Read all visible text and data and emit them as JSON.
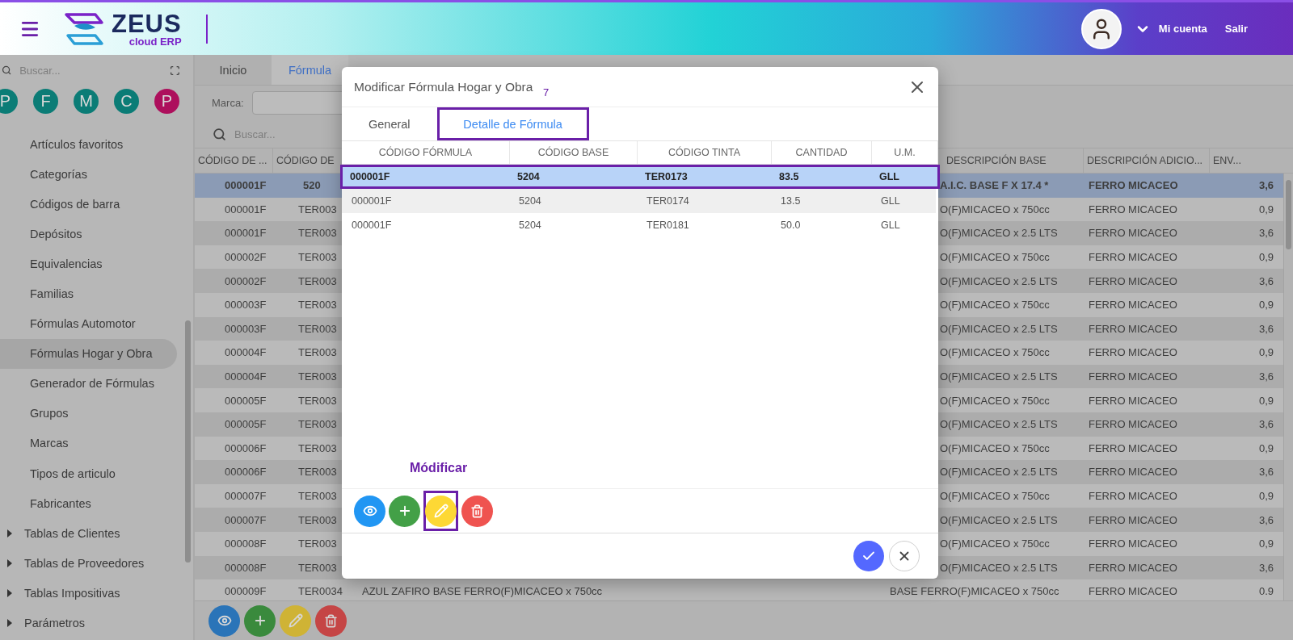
{
  "header": {
    "brand": "ZEUS",
    "tagline": "cloud ERP",
    "account": "Mi cuenta",
    "logout": "Salir"
  },
  "sidebar": {
    "search_placeholder": "Buscar...",
    "shortcuts": [
      {
        "letter": "P",
        "color": "#0b7c76"
      },
      {
        "letter": "F",
        "color": "#0b7c76"
      },
      {
        "letter": "M",
        "color": "#0b7c76"
      },
      {
        "letter": "C",
        "color": "#0b7c76"
      },
      {
        "letter": "P",
        "color": "#ad0f5c"
      }
    ],
    "items": [
      {
        "children": [
          {
            "label": "Artículos favoritos",
            "selected": false
          },
          {
            "label": "Categorías",
            "selected": false
          },
          {
            "label": "Códigos de barra",
            "selected": false
          },
          {
            "label": "Depósitos",
            "selected": false
          },
          {
            "label": "Equivalencias",
            "selected": false
          },
          {
            "label": "Familias",
            "selected": false
          },
          {
            "label": "Fórmulas Automotor",
            "selected": false
          },
          {
            "label": "Fórmulas Hogar y Obra",
            "selected": true
          },
          {
            "label": "Generador de Fórmulas",
            "selected": false
          },
          {
            "label": "Grupos",
            "selected": false
          },
          {
            "label": "Marcas",
            "selected": false
          },
          {
            "label": "Tipos de articulo",
            "selected": false
          },
          {
            "label": "Fabricantes",
            "selected": false
          }
        ]
      },
      {
        "label": "Tablas de Clientes",
        "expanded": false
      },
      {
        "label": "Tablas de Proveedores",
        "expanded": false
      },
      {
        "label": "Tablas Impositivas",
        "expanded": false
      },
      {
        "label": "Parámetros",
        "expanded": false
      }
    ]
  },
  "tabs": [
    {
      "label": "Inicio",
      "selected": false
    },
    {
      "label": "Fórmula",
      "selected": true
    }
  ],
  "filter": {
    "label": "Marca:"
  },
  "search": {
    "placeholder": "Buscar..."
  },
  "table": {
    "columns": [
      "CÓDIGO DE ...",
      "CÓDIGO DE",
      "DESCRIPCIÓN BASE",
      "DESCRIPCIÓN ADICIO...",
      "ENV..."
    ],
    "rows": [
      {
        "code": "000001F",
        "column_2": "520",
        "description_base": "A.I.C. BASE F X 17.4 *",
        "description_extra": "FERRO MICACEO",
        "env": "3,6",
        "selected": true
      },
      {
        "code": "000001F",
        "column_2": "TER003",
        "description_base": "O(F)MICACEO x 750cc",
        "description_extra": "FERRO MICACEO",
        "env": "0,9",
        "selected": false
      },
      {
        "code": "000001F",
        "column_2": "TER003",
        "description_base": "O(F)MICACEO x 2.5 LTS",
        "description_extra": "FERRO MICACEO",
        "env": "3,6",
        "selected": false
      },
      {
        "code": "000002F",
        "column_2": "TER003",
        "description_base": "O(F)MICACEO x 750cc",
        "description_extra": "FERRO MICACEO",
        "env": "0,9",
        "selected": false
      },
      {
        "code": "000002F",
        "column_2": "TER003",
        "description_base": "O(F)MICACEO x 2.5 LTS",
        "description_extra": "FERRO MICACEO",
        "env": "3,6",
        "selected": false
      },
      {
        "code": "000003F",
        "column_2": "TER003",
        "description_base": "O(F)MICACEO x 750cc",
        "description_extra": "FERRO MICACEO",
        "env": "0,9",
        "selected": false
      },
      {
        "code": "000003F",
        "column_2": "TER003",
        "description_base": "O(F)MICACEO x 2.5 LTS",
        "description_extra": "FERRO MICACEO",
        "env": "3,6",
        "selected": false
      },
      {
        "code": "000004F",
        "column_2": "TER003",
        "description_base": "O(F)MICACEO x 750cc",
        "description_extra": "FERRO MICACEO",
        "env": "0,9",
        "selected": false
      },
      {
        "code": "000004F",
        "column_2": "TER003",
        "description_base": "O(F)MICACEO x 2.5 LTS",
        "description_extra": "FERRO MICACEO",
        "env": "3,6",
        "selected": false
      },
      {
        "code": "000005F",
        "column_2": "TER003",
        "description_base": "O(F)MICACEO x 750cc",
        "description_extra": "FERRO MICACEO",
        "env": "0,9",
        "selected": false
      },
      {
        "code": "000005F",
        "column_2": "TER003",
        "description_base": "O(F)MICACEO x 2.5 LTS",
        "description_extra": "FERRO MICACEO",
        "env": "3,6",
        "selected": false
      },
      {
        "code": "000006F",
        "column_2": "TER003",
        "description_base": "O(F)MICACEO x 750cc",
        "description_extra": "FERRO MICACEO",
        "env": "0,9",
        "selected": false
      },
      {
        "code": "000006F",
        "column_2": "TER003",
        "description_base": "O(F)MICACEO x 2.5 LTS",
        "description_extra": "FERRO MICACEO",
        "env": "3,6",
        "selected": false
      },
      {
        "code": "000007F",
        "column_2": "TER003",
        "description_base": "O(F)MICACEO x 750cc",
        "description_extra": "FERRO MICACEO",
        "env": "0,9",
        "selected": false
      },
      {
        "code": "000007F",
        "column_2": "TER003",
        "description_base": "O(F)MICACEO x 2.5 LTS",
        "description_extra": "FERRO MICACEO",
        "env": "3,6",
        "selected": false
      },
      {
        "code": "000008F",
        "column_2": "TER003",
        "description_base": "O(F)MICACEO x 750cc",
        "description_extra": "FERRO MICACEO",
        "env": "0,9",
        "selected": false
      },
      {
        "code": "000008F",
        "column_2": "TER003",
        "description_base": "O(F)MICACEO x 2.5 LTS",
        "description_extra": "FERRO MICACEO",
        "env": "3,6",
        "selected": false
      },
      {
        "code": "000009F",
        "column_2": "TER0034",
        "description": "AZUL ZAFIRO BASE FERRO(F)MICACEO x 750cc",
        "description_base": "BASE FERRO(F)MICACEO x 750cc",
        "description_extra": "FERRO MICACEO",
        "env": "0.9",
        "selected": false
      }
    ]
  },
  "toolbar": [
    {
      "kind": "view"
    },
    {
      "kind": "add"
    },
    {
      "kind": "edit"
    },
    {
      "kind": "delete"
    }
  ],
  "dialog": {
    "title": "Modificar Fórmula Hogar y Obra",
    "step_label": "7",
    "tabs": [
      {
        "label": "General",
        "selected": false,
        "highlighted": false
      },
      {
        "label": "Detalle de Fórmula",
        "selected": true,
        "highlighted": true
      }
    ],
    "columns": [
      "CÓDIGO FÓRMULA",
      "CÓDIGO BASE",
      "CÓDIGO TINTA",
      "CANTIDAD",
      "U.M."
    ],
    "rows": [
      {
        "cells": [
          "000001F",
          "5204",
          "TER0173",
          "83.5",
          "GLL"
        ],
        "selected": true,
        "highlighted": true
      },
      {
        "cells": [
          "000001F",
          "5204",
          "TER0174",
          "13.5",
          "GLL"
        ],
        "selected": false,
        "highlighted": false
      },
      {
        "cells": [
          "000001F",
          "5204",
          "TER0181",
          "50.0",
          "GLL"
        ],
        "selected": false,
        "highlighted": false
      }
    ],
    "callout": "Módificar",
    "actions": [
      {
        "kind": "view",
        "highlighted": false
      },
      {
        "kind": "add",
        "highlighted": false
      },
      {
        "kind": "edit",
        "highlighted": true
      },
      {
        "kind": "delete",
        "highlighted": false
      }
    ],
    "footer": [
      {
        "kind": "confirm"
      },
      {
        "kind": "cancel"
      }
    ]
  }
}
